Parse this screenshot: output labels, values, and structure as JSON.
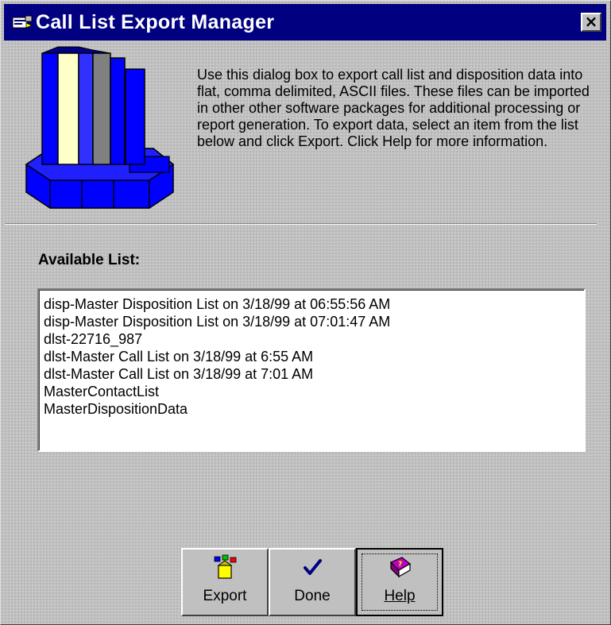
{
  "window": {
    "title": "Call List Export Manager",
    "close_label": "×",
    "title_bar_color": "#000080"
  },
  "description": "Use this dialog box to export call list and disposition data into flat, comma delimited, ASCII files. These files can be imported in other other software packages for additional processing or report generation. To export data, select an item from the list below and click Export. Click Help for more information.",
  "list_label": "Available List:",
  "list_items": [
    "disp-Master Disposition List on 3/18/99 at 06:55:56 AM",
    "disp-Master Disposition List on 3/18/99 at 07:01:47 AM",
    "dlst-22716_987",
    "dlst-Master Call List on 3/18/99 at 6:55 AM",
    "dlst-Master Call List on 3/18/99 at 7:01 AM",
    "MasterContactList",
    "MasterDispositionData"
  ],
  "buttons": {
    "export": {
      "label": "Export",
      "icon": "export-icon"
    },
    "done": {
      "label": "Done",
      "icon": "checkmark-icon"
    },
    "help": {
      "label": "Help",
      "icon": "help-book-icon"
    }
  }
}
